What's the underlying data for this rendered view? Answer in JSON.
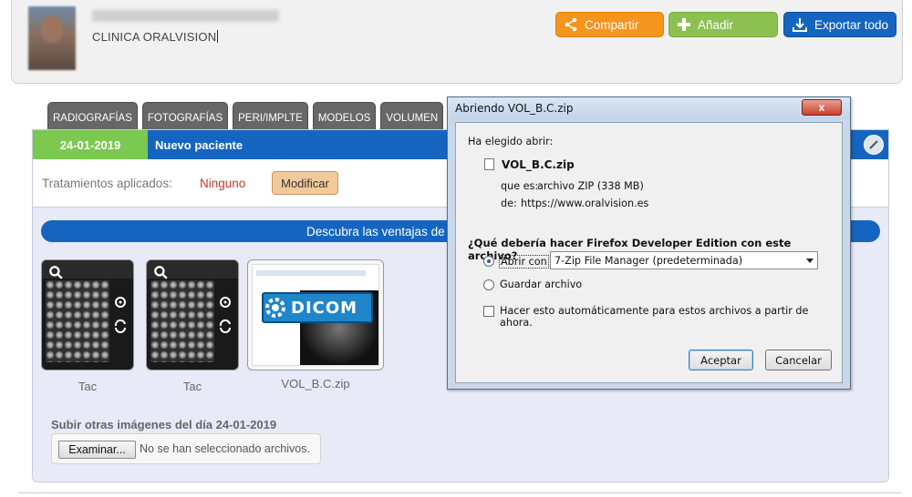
{
  "header": {
    "clinic_name": "CLINICA ORALVISION",
    "buttons": {
      "share": "Compartir",
      "add": "Añadir",
      "export": "Exportar todo"
    }
  },
  "tabs": [
    "RADIOGRAFÍAS",
    "FOTOGRAFÍAS",
    "PERI/IMPLTE",
    "MODELOS",
    "VOLUMEN"
  ],
  "panel": {
    "date": "24-01-2019",
    "title": "Nuevo paciente",
    "treatments_label": "Tratamientos aplicados:",
    "treatments_value": "Ninguno",
    "modify_button": "Modificar",
    "banner": "Descubra las ventajas de",
    "thumbnails": [
      {
        "label": "Tac"
      },
      {
        "label": "Tac"
      }
    ],
    "dicom": {
      "logo_text": "DICOM",
      "label": "VOL_B.C.zip"
    },
    "upload": {
      "title": "Subir otras imágenes del día 24-01-2019",
      "browse_button": "Examinar...",
      "status": "No se han seleccionado archivos."
    }
  },
  "dialog": {
    "title": "Abriendo VOL_B.C.zip",
    "close": "x",
    "chosen_label": "Ha elegido abrir:",
    "file_name": "VOL_B.C.zip",
    "which_is_label": "que es:",
    "which_is_value": "archivo ZIP (338 MB)",
    "from_label": "de:",
    "from_value": "https://www.oralvision.es",
    "question": "¿Qué debería hacer Firefox Developer Edition con este archivo?",
    "open_with_label": "Abrir con",
    "open_with_app": "7-Zip File Manager (predeterminada)",
    "save_label": "Guardar archivo",
    "auto_label": "Hacer esto automáticamente para estos archivos a partir de ahora.",
    "ok_button": "Aceptar",
    "cancel_button": "Cancelar"
  },
  "colors": {
    "share": "#f7941d",
    "add": "#8cc152",
    "export": "#1565c0",
    "date_badge": "#7bc950",
    "treatment_value": "#c0392b"
  }
}
